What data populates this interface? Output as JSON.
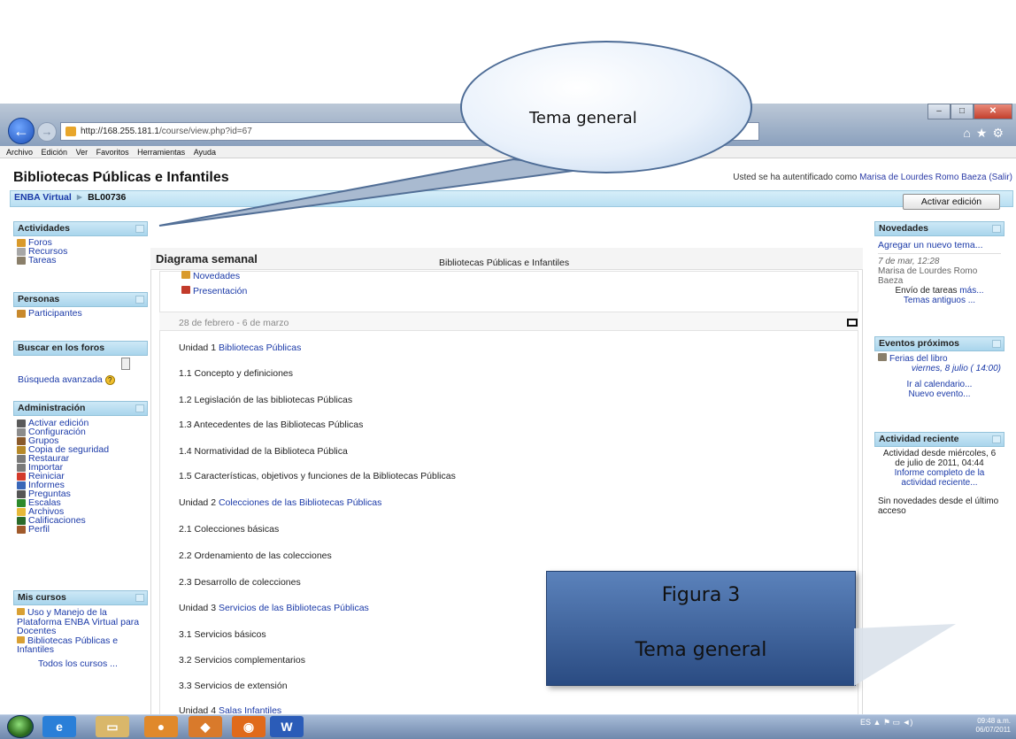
{
  "browser": {
    "url_host": "http://168.255.181.1",
    "url_path": "/course/view.php?id=67",
    "menus": [
      "Archivo",
      "Edición",
      "Ver",
      "Favoritos",
      "Herramientas",
      "Ayuda"
    ]
  },
  "header": {
    "course_title": "Bibliotecas Públicas e Infantiles",
    "login_prefix": "Usted se ha autentificado como",
    "login_user": "Marisa de Lourdes Romo Baeza",
    "logout": "(Salir)"
  },
  "nav": {
    "root": "ENBA Virtual",
    "separator": "►",
    "current": "BL00736",
    "edit_button": "Activar edición"
  },
  "left": {
    "activities": {
      "title": "Actividades",
      "items": [
        "Foros",
        "Recursos",
        "Tareas"
      ]
    },
    "people": {
      "title": "Personas",
      "items": [
        "Participantes"
      ]
    },
    "search": {
      "title": "Buscar en los foros",
      "advanced": "Búsqueda avanzada"
    },
    "admin": {
      "title": "Administración",
      "items": [
        "Activar edición",
        "Configuración",
        "Grupos",
        "Copia de seguridad",
        "Restaurar",
        "Importar",
        "Reiniciar",
        "Informes",
        "Preguntas",
        "Escalas",
        "Archivos",
        "Calificaciones",
        "Perfil"
      ]
    },
    "courses": {
      "title": "Mis cursos",
      "items": [
        "Uso y Manejo de la Plataforma ENBA Virtual para Docentes",
        "Bibliotecas Públicas e Infantiles"
      ],
      "all": "Todos los cursos ..."
    }
  },
  "main": {
    "heading": "Diagrama semanal",
    "course_name": "Bibliotecas Públicas e Infantiles",
    "links": [
      "Novedades",
      "Presentación"
    ],
    "week": "28 de febrero - 6 de marzo",
    "topics": [
      {
        "label": "Unidad 1",
        "link": "Bibliotecas Públicas"
      },
      {
        "label": "1.1 Concepto y definiciones",
        "link": ""
      },
      {
        "label": "1.2 Legislación de las bibliotecas Públicas",
        "link": ""
      },
      {
        "label": "1.3 Antecedentes de las Bibliotecas Públicas",
        "link": ""
      },
      {
        "label": "1.4 Normatividad de la Biblioteca Pública",
        "link": ""
      },
      {
        "label": "1.5 Características, objetivos y funciones de la Bibliotecas Públicas",
        "link": ""
      },
      {
        "label": "Unidad 2",
        "link": "Colecciones de las Bibliotecas Públicas"
      },
      {
        "label": "2.1 Colecciones básicas",
        "link": ""
      },
      {
        "label": "2.2 Ordenamiento de las colecciones",
        "link": ""
      },
      {
        "label": "2.3 Desarrollo de colecciones",
        "link": ""
      },
      {
        "label": "Unidad 3",
        "link": "Servicios de las Bibliotecas Públicas"
      },
      {
        "label": "3.1 Servicios básicos",
        "link": ""
      },
      {
        "label": "3.2 Servicios complementarios",
        "link": ""
      },
      {
        "label": "3.3 Servicios de extensión",
        "link": ""
      },
      {
        "label": "Unidad 4",
        "link": "Salas Infantiles"
      }
    ]
  },
  "right": {
    "news": {
      "title": "Novedades",
      "add": "Agregar un nuevo tema...",
      "date": "7 de mar, 12:28",
      "author": "Marisa de Lourdes Romo Baeza",
      "post": "Envío de tareas",
      "more": "más...",
      "old": "Temas antiguos ..."
    },
    "events": {
      "title": "Eventos próximos",
      "event": "Ferias del libro",
      "event_date": "viernes, 8 julio ( 14:00)",
      "calendar": "Ir al calendario...",
      "new_event": "Nuevo evento..."
    },
    "recent": {
      "title": "Actividad reciente",
      "since": "Actividad desde miércoles, 6 de julio de 2011, 04:44",
      "report": "Informe completo de la actividad reciente...",
      "none": "Sin novedades desde el último acceso"
    }
  },
  "taskbar": {
    "lang": "ES",
    "time": "09:48 a.m.",
    "date": "06/07/2011"
  },
  "overlays": {
    "callout": "Tema general",
    "figure_title": "Figura 3",
    "figure_sub": "Tema general"
  }
}
